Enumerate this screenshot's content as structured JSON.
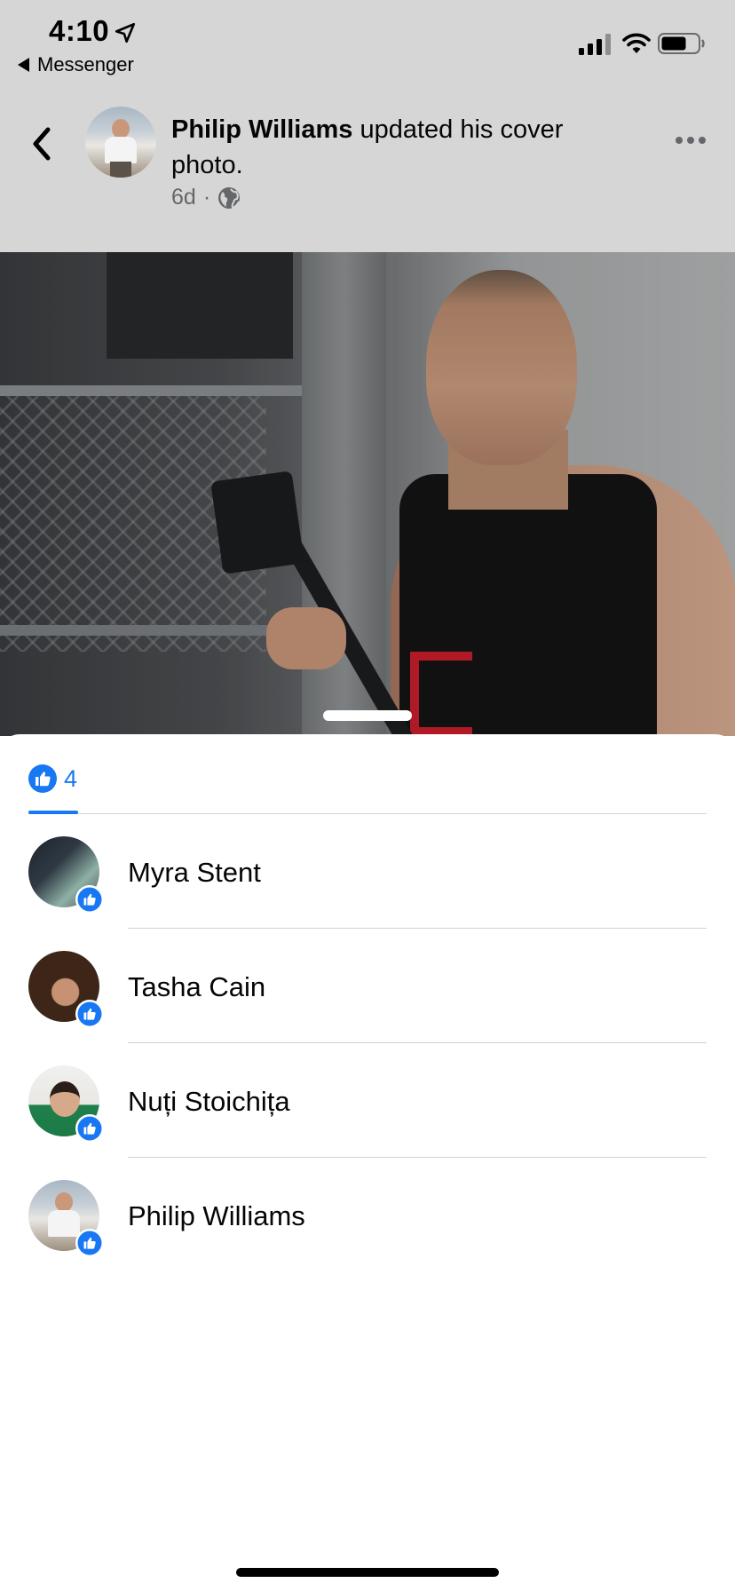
{
  "status_bar": {
    "time": "4:10",
    "back_app": "Messenger"
  },
  "post": {
    "author": "Philip Williams",
    "action": " updated his cover photo.",
    "age": "6d",
    "separator": "·",
    "privacy_icon": "globe-icon"
  },
  "reactions": {
    "tab": {
      "type": "like",
      "count": "4"
    },
    "people": [
      {
        "name": "Myra Stent",
        "reaction": "like"
      },
      {
        "name": "Tasha Cain",
        "reaction": "like"
      },
      {
        "name": "Nuți Stoichița",
        "reaction": "like"
      },
      {
        "name": "Philip Williams",
        "reaction": "like"
      }
    ]
  },
  "colors": {
    "accent": "#1877f2",
    "dim_overlay": "#d6d6d6",
    "text_primary": "#050505",
    "text_secondary": "#65676b"
  }
}
